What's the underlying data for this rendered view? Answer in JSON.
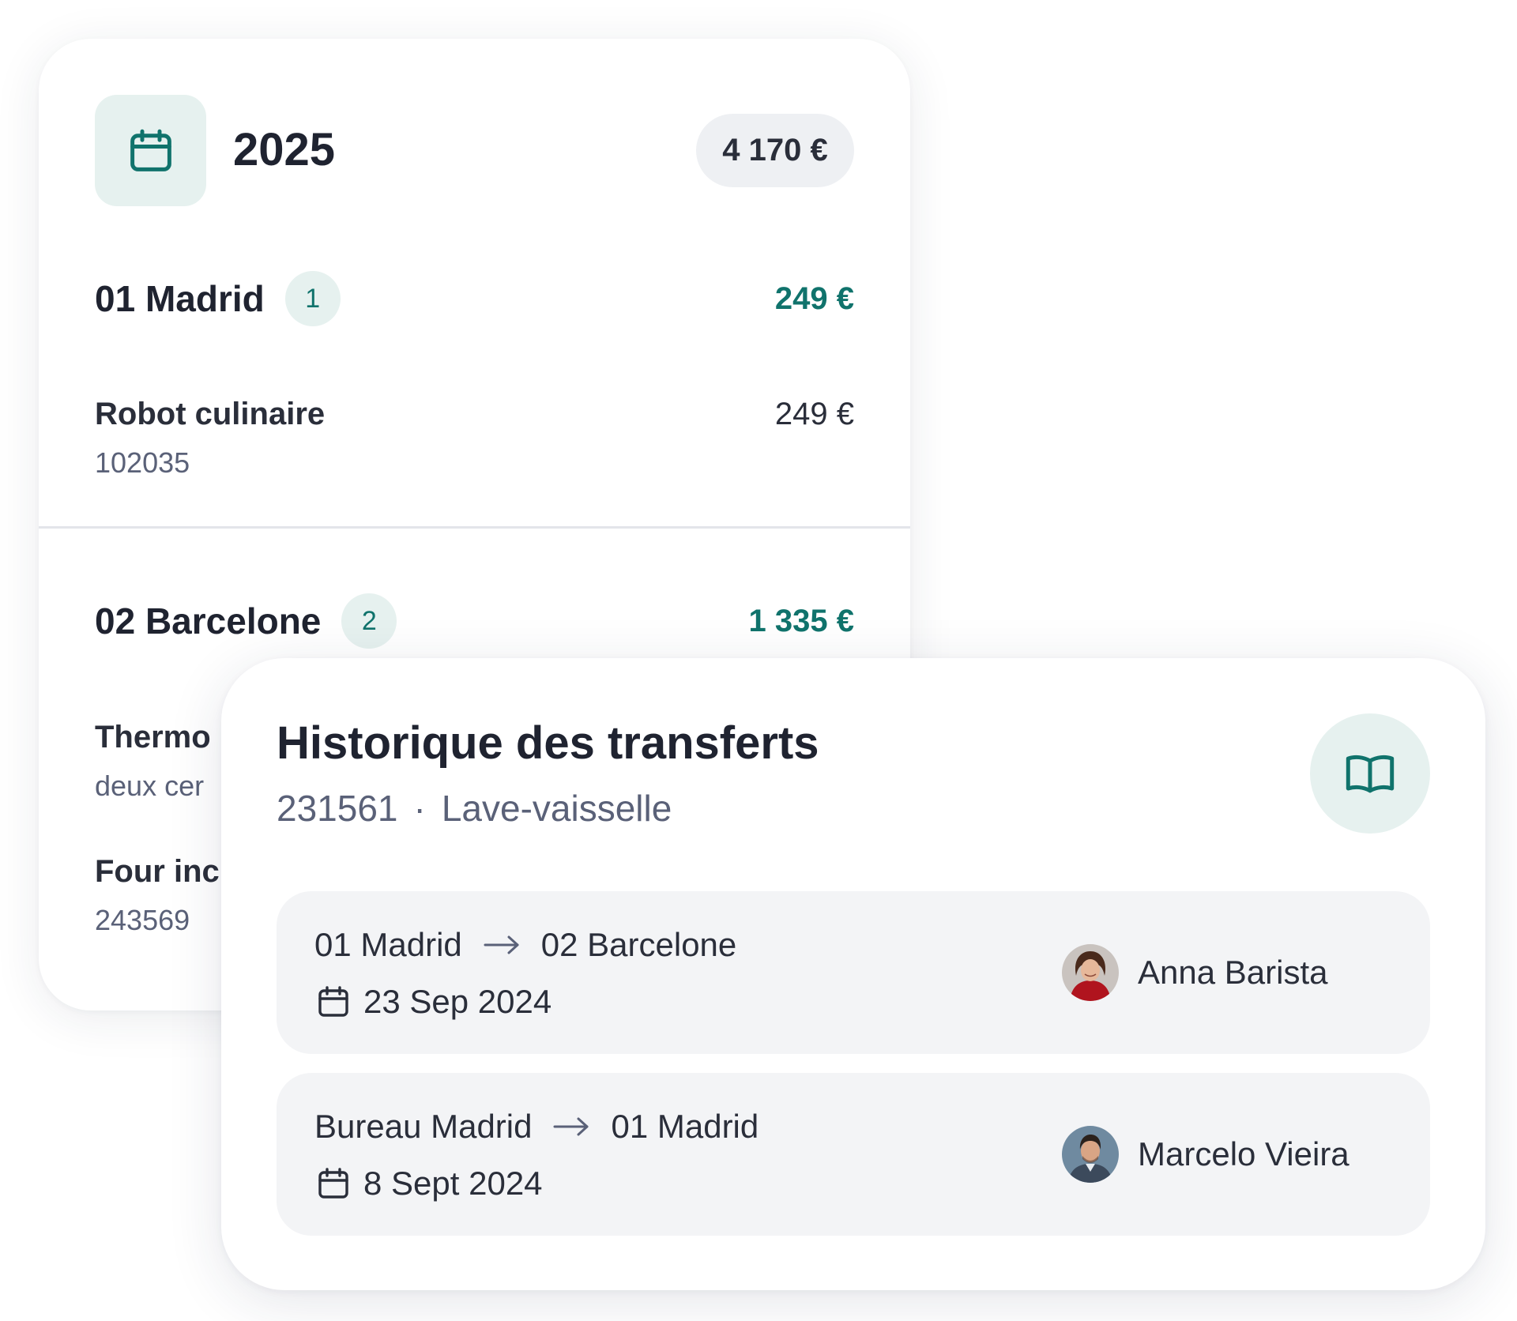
{
  "year_card": {
    "year": "2025",
    "total": "4 170 €",
    "icon": "calendar-icon",
    "locations": [
      {
        "name": "01 Madrid",
        "count": "1",
        "total": "249 €",
        "items": [
          {
            "name": "Robot culinaire",
            "code": "102035",
            "price": "249 €"
          }
        ]
      },
      {
        "name": "02 Barcelone",
        "count": "2",
        "total": "1 335 €",
        "items": [
          {
            "name": "Thermo",
            "code": "deux cer"
          },
          {
            "name": "Four inc",
            "code": "243569"
          }
        ]
      }
    ]
  },
  "history": {
    "title": "Historique des transferts",
    "item_code": "231561",
    "separator": "·",
    "item_name": "Lave-vaisselle",
    "icon": "book-icon",
    "transfers": [
      {
        "from": "01 Madrid",
        "to": "02 Barcelone",
        "date": "23 Sep 2024",
        "person": "Anna Barista"
      },
      {
        "from": "Bureau Madrid",
        "to": "01 Madrid",
        "date": "8 Sept 2024",
        "person": "Marcelo Vieira"
      }
    ]
  },
  "colors": {
    "accent": "#10736c",
    "accent_soft": "#e6f1ef",
    "text": "#1f2330",
    "muted": "#5a6178",
    "row_bg": "#f3f4f6"
  }
}
